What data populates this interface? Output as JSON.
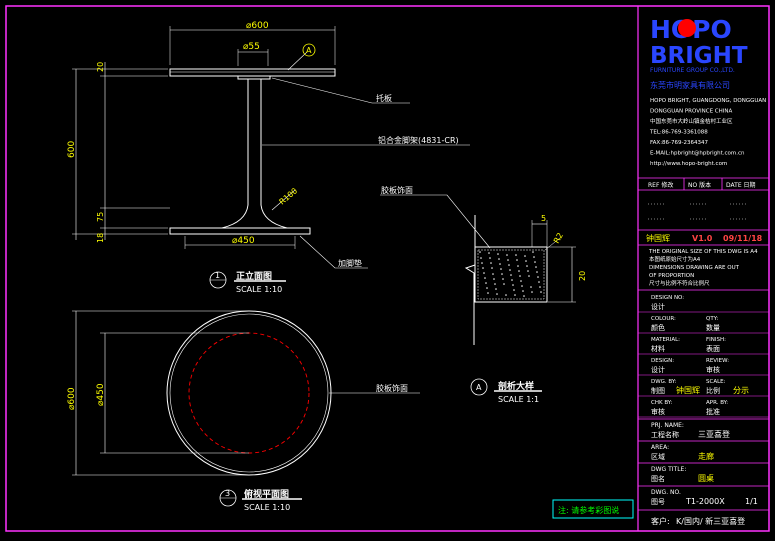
{
  "title_block": {
    "logo_line1": "HOPO",
    "logo_line2": "BRIGHT",
    "logo_sub": "FURNITURE GROUP CO.,LTD.",
    "company_cn": "东莞市明家具有限公司",
    "address_lines": [
      "HOPO BRIGHT, GUANGDONG, DONGGUAN",
      "DONGGUAN PROVINCE CHINA",
      "中国东莞市大岭山镇金桔村工业区",
      "TEL:86-769-3361088",
      "FAX:86-769-2364347",
      "E-MAIL:hpbright@hpbright.com.cn",
      "http://www.hopo-bright.com"
    ],
    "rev_header": [
      "REF 修改",
      "NO 版本",
      "DATE 日期"
    ],
    "version_name": "钟国辉",
    "version_no": "V1.0",
    "version_date": "09/11/18",
    "notes": [
      "THE ORIGINAL SIZE OF THIS DWG IS A4",
      "本图纸原始尺寸为A4",
      "DIMENSIONS DRAWING ARE OUT",
      "OF PROPORTION",
      "尺寸与比例不符合比例尺"
    ],
    "rows": [
      {
        "label_en": "DESIGN NO:",
        "label_cn": "设计",
        "value": "",
        "label2_en": "",
        "label2_cn": "",
        "value2": ""
      },
      {
        "label_en": "COLOUR:",
        "label_cn": "颜色",
        "value": "",
        "label2_en": "QTY:",
        "label2_cn": "数量",
        "value2": ""
      },
      {
        "label_en": "MATERIAL:",
        "label_cn": "材料",
        "value": "",
        "label2_en": "FINISH:",
        "label2_cn": "表面",
        "value2": ""
      },
      {
        "label_en": "DESIGN:",
        "label_cn": "设计",
        "value": "",
        "label2_en": "REVIEW:",
        "label2_cn": "审核",
        "value2": ""
      },
      {
        "label_en": "DWG. BY:",
        "label_cn": "制图",
        "value": "钟国辉",
        "label2_en": "SCALE:",
        "label2_cn": "比例",
        "value2": "分示"
      },
      {
        "label_en": "CHK BY:",
        "label_cn": "审核",
        "value": "",
        "label2_en": "APR. BY:",
        "label2_cn": "批准",
        "value2": ""
      }
    ],
    "prj_label_en": "PRJ. NAME:",
    "prj_label_cn": "工程名称",
    "prj_value": "三亚喜登",
    "area_label_en": "AREA:",
    "area_label_cn": "区域",
    "area_value": "走廊",
    "dwg_title_label_en": "DWG TITLE:",
    "dwg_title_label_cn": "图名",
    "dwg_title_value": "圆桌",
    "dwg_no_label_en": "DWG. NO.",
    "dwg_no_label_cn": "图号",
    "dwg_no_value": "T1-2000X",
    "sheet_value": "1/1",
    "client_label": "客户:",
    "client_value": "K/国内/ 新三亚喜登"
  },
  "elevation": {
    "dim_top_width": "⌀600",
    "dim_stem": "⌀55",
    "section_marker": "A",
    "dim_top_thk": "20",
    "dim_height": "600",
    "dim_base_h": "75",
    "dim_base_t": "18",
    "dim_radius": "R100",
    "dim_base_w": "⌀450",
    "callout_plate": "托板",
    "callout_frame": "铝合金脚架(4831-CR)",
    "callout_foot": "加脚垫",
    "view_no": "1",
    "view_title": "正立面图",
    "view_scale": "SCALE 1:10"
  },
  "section": {
    "callout_edge": "胶板饰面",
    "dim_5": "5",
    "dim_r2": "R2",
    "dim_20": "20",
    "marker": "A",
    "view_title": "剖析大样",
    "view_scale": "SCALE 1:1"
  },
  "plan": {
    "dim_outer": "⌀600",
    "dim_inner": "⌀450",
    "callout_surface": "胶板饰面",
    "view_no": "3",
    "view_title": "俯视平面图",
    "view_scale": "SCALE 1:10"
  },
  "note_box": "注: 请参考彩图说",
  "colors": {
    "frame": "#ff33ff",
    "line": "#ffffff",
    "dim": "#ffff00",
    "logo_blue": "#2a46ff",
    "logo_red": "#ff0000",
    "note_box": "#00ffff",
    "version": "#ff4444",
    "hidden_circle": "#ff0000"
  }
}
